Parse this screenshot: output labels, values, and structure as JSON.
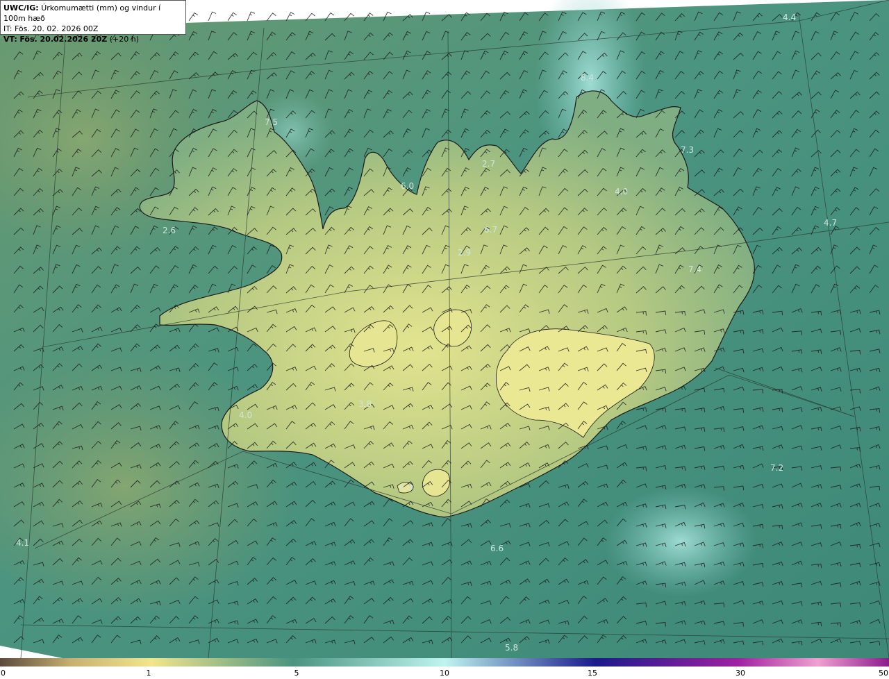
{
  "header": {
    "model": "UWC/IG:",
    "title": "Úrkomumætti (mm) og vindur í 100m hæð",
    "it_label": "IT:",
    "it_value": "Fös. 20. 02. 2026 00Z",
    "vt_label": "VT:",
    "vt_value": "Fös. 20.02.2026 20Z",
    "vt_offset": "(+20 h)"
  },
  "map": {
    "background_colors": {
      "ocean": "#4a9480",
      "land_low": "#a9c27d",
      "land_high": "#e3e48f",
      "wet": "#7ec7c0"
    },
    "value_labels": [
      {
        "text": "4.4"
      },
      {
        "text": "8.4"
      },
      {
        "text": "7.5"
      },
      {
        "text": "7.3"
      },
      {
        "text": "2.7"
      },
      {
        "text": "6.0"
      },
      {
        "text": "4.0"
      },
      {
        "text": "2.6"
      },
      {
        "text": "6.7"
      },
      {
        "text": "4.7"
      },
      {
        "text": "2.9"
      },
      {
        "text": "7.4"
      },
      {
        "text": "3.8"
      },
      {
        "text": "4.0"
      },
      {
        "text": "6.0"
      },
      {
        "text": "7.2"
      },
      {
        "text": "4.1"
      },
      {
        "text": "6.6"
      },
      {
        "text": "5.8"
      }
    ]
  },
  "colorbar": {
    "ticks": [
      "0",
      "1",
      "5",
      "10",
      "15",
      "30",
      "50"
    ],
    "colors": [
      "#5a4a3c",
      "#c8b070",
      "#f2e58c",
      "#4a9480",
      "#bff5f0",
      "#1a1a8c",
      "#a020a0",
      "#f0a0d0",
      "#8c1a8c"
    ]
  }
}
